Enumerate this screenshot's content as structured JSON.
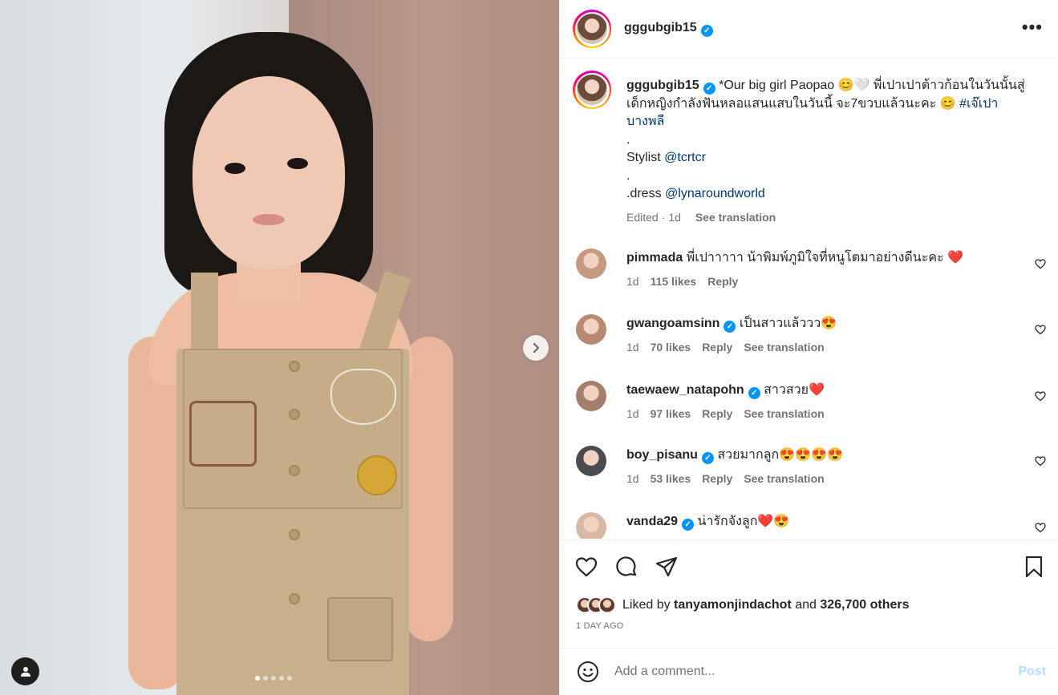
{
  "post": {
    "username": "gggubgib15",
    "more_label": "•••",
    "caption": {
      "username": "gggubgib15",
      "text": "*Our big girl Paopao 😊🤍 พี่เปาเปาต้าวก้อนในวันนั้นสู่เด็กหญิงกำลังฟันหลอแสนแสบในวันนี้ จะ7ขวบแล้วนะคะ 😊",
      "hashtag": "#เจ๊เปาบางพลี",
      "dot1": ".",
      "stylist_prefix": "Stylist",
      "stylist_tag": "@tcrtcr",
      "dot2": ".",
      "dress_prefix": ".dress",
      "dress_tag": "@lynaroundworld",
      "edited": "Edited",
      "age": "1d",
      "see_translation": "See translation"
    },
    "comments": [
      {
        "username": "pimmada",
        "verified": false,
        "text": "พี่เปาาาาา น้าพิมพ์ภูมิใจที่หนูโตมาอย่างดีนะคะ ❤️",
        "age": "1d",
        "likes": "115 likes",
        "reply": "Reply",
        "see_translation": "",
        "avatar_color": "#c69a82"
      },
      {
        "username": "gwangoamsinn",
        "verified": true,
        "text": "เป็นสาวแล้ววว😍",
        "age": "1d",
        "likes": "70 likes",
        "reply": "Reply",
        "see_translation": "See translation",
        "avatar_color": "#b88a73"
      },
      {
        "username": "taewaew_natapohn",
        "verified": true,
        "text": "สาวสวย❤️",
        "age": "1d",
        "likes": "97 likes",
        "reply": "Reply",
        "see_translation": "See translation",
        "avatar_color": "#a37f6c"
      },
      {
        "username": "boy_pisanu",
        "verified": true,
        "text": "สวยมากลูก😍😍😍😍",
        "age": "1d",
        "likes": "53 likes",
        "reply": "Reply",
        "see_translation": "See translation",
        "avatar_color": "#4a4a4f"
      },
      {
        "username": "vanda29",
        "verified": true,
        "text": "น่ารักจังลูก❤️😍",
        "age": "",
        "likes": "",
        "reply": "",
        "see_translation": "",
        "avatar_color": "#d9b9a6"
      }
    ],
    "likes": {
      "prefix": "Liked by",
      "user": "tanyamonjindachot",
      "and": "and",
      "others": "326,700 others"
    },
    "timestamp": "1 DAY AGO",
    "add_comment": {
      "placeholder": "Add a comment...",
      "post_label": "Post"
    },
    "carousel": {
      "total_slides": 5,
      "active_slide": 1
    }
  },
  "colors": {
    "link": "#00376b",
    "verified": "#0095f6",
    "muted": "#737373",
    "post_disabled": "#b2dffc"
  }
}
